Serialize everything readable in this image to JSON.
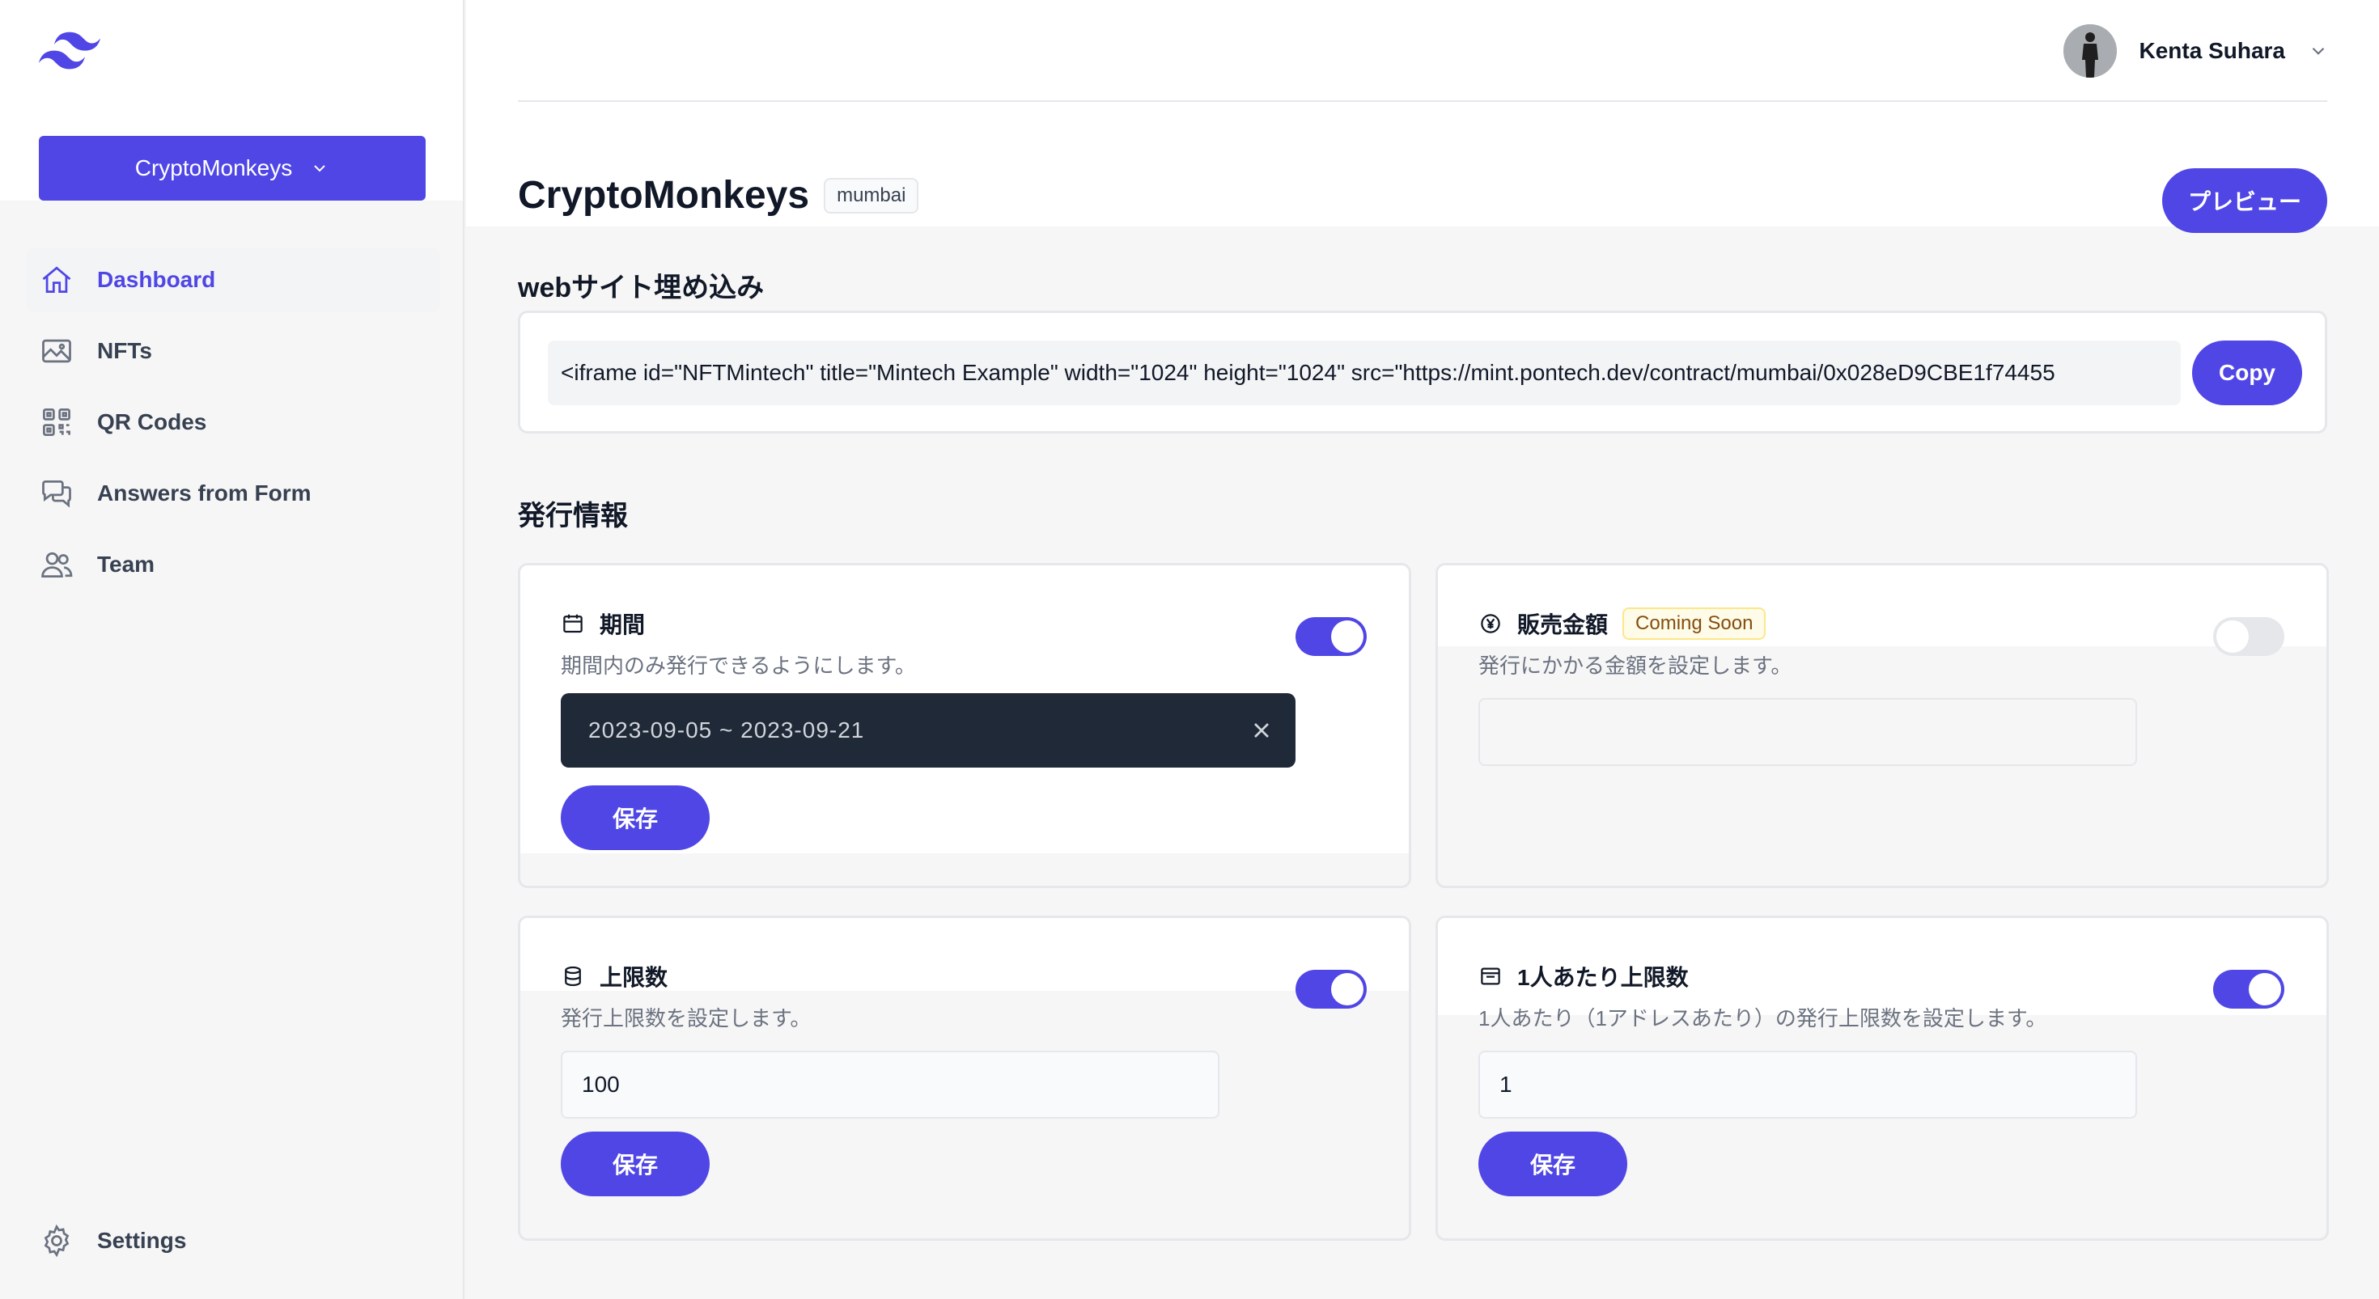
{
  "sidebar": {
    "project_selector": "CryptoMonkeys",
    "items": [
      {
        "label": "Dashboard",
        "icon": "home-icon",
        "active": true
      },
      {
        "label": "NFTs",
        "icon": "image-icon",
        "active": false
      },
      {
        "label": "QR Codes",
        "icon": "qr-code-icon",
        "active": false
      },
      {
        "label": "Answers from Form",
        "icon": "chat-bubbles-icon",
        "active": false
      },
      {
        "label": "Team",
        "icon": "users-icon",
        "active": false
      }
    ],
    "bottom_item": {
      "label": "Settings",
      "icon": "gear-icon"
    }
  },
  "header": {
    "user_name": "Kenta Suhara"
  },
  "page": {
    "title": "CryptoMonkeys",
    "network_badge": "mumbai",
    "preview_label": "プレビュー"
  },
  "embed": {
    "section_title": "webサイト埋め込み",
    "code": "<iframe id=\"NFTMintech\" title=\"Mintech Example\" width=\"1024\" height=\"1024\" src=\"https://mint.pontech.dev/contract/mumbai/0x028eD9CBE1f74455",
    "copy_label": "Copy"
  },
  "issue": {
    "section_title": "発行情報",
    "period": {
      "title": "期間",
      "description": "期間内のみ発行できるようにします。",
      "value": "2023-09-05 ~ 2023-09-21",
      "enabled": true,
      "save_label": "保存"
    },
    "price": {
      "title": "販売金額",
      "badge": "Coming Soon",
      "description": "発行にかかる金額を設定します。",
      "value": "",
      "enabled": false
    },
    "max_supply": {
      "title": "上限数",
      "description": "発行上限数を設定します。",
      "value": "100",
      "enabled": true,
      "save_label": "保存"
    },
    "per_person": {
      "title": "1人あたり上限数",
      "description": "1人あたり（1アドレスあたり）の発行上限数を設定します。",
      "value": "1",
      "enabled": true,
      "save_label": "保存"
    }
  },
  "colors": {
    "accent": "#4f46e5",
    "background": "#f6f6f6",
    "date_input_bg": "#1f2937"
  }
}
